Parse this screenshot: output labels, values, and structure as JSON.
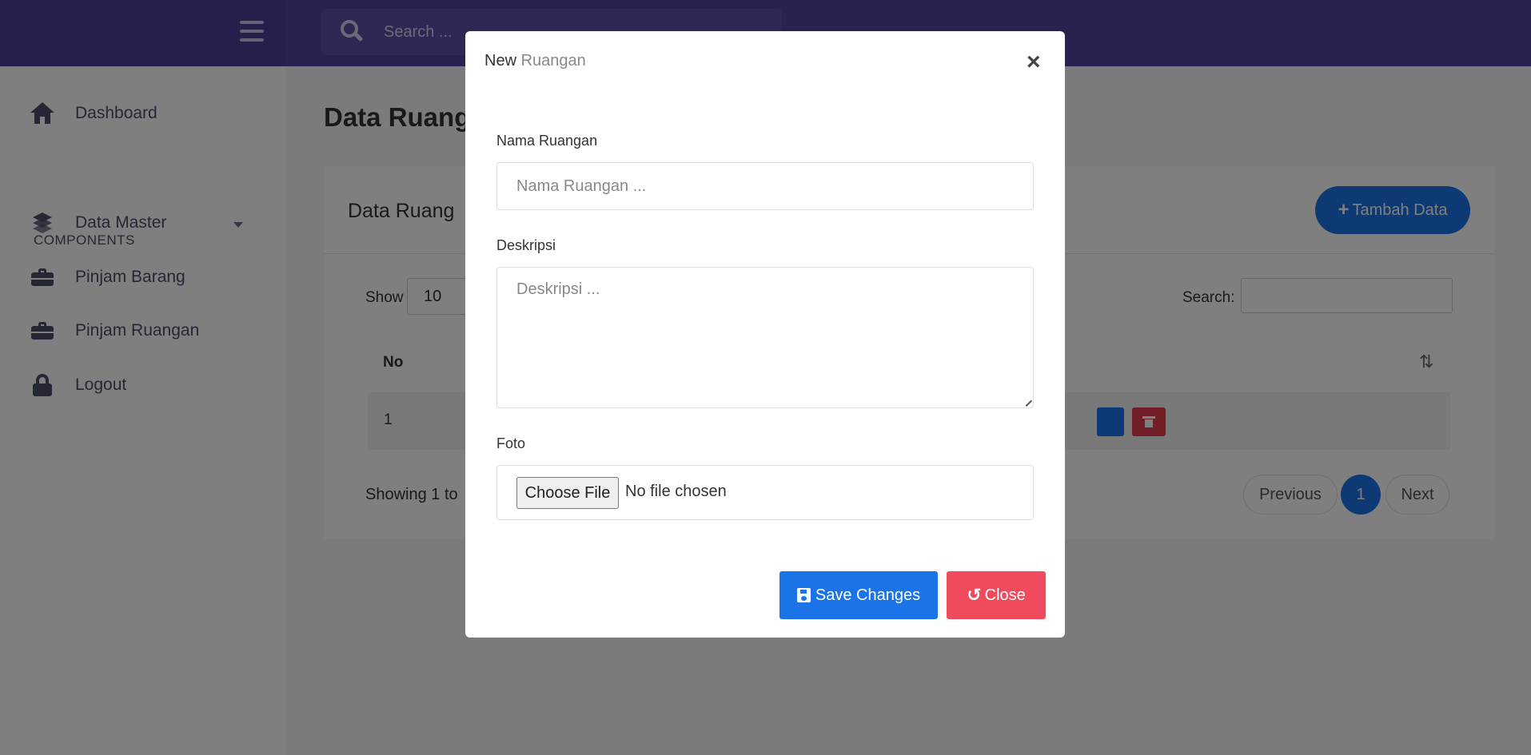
{
  "topbar": {
    "search_placeholder": "Search ..."
  },
  "sidebar": {
    "dashboard": "Dashboard",
    "section": "COMPONENTS",
    "data_master": "Data Master",
    "pinjam_barang": "Pinjam Barang",
    "pinjam_ruangan": "Pinjam Ruangan",
    "logout": "Logout"
  },
  "main": {
    "title": "Data Ruang",
    "card_title": "Data Ruang",
    "add_button": "Tambah Data",
    "show_label": "Show",
    "show_value": "10",
    "search_label": "Search:",
    "col_no": "No",
    "row_no": "1",
    "showing": "Showing 1 to",
    "prev": "Previous",
    "page": "1",
    "next": "Next"
  },
  "modal": {
    "title_new": "New",
    "title_entity": "Ruangan",
    "close_symbol": "×",
    "name_label": "Nama Ruangan",
    "name_placeholder": "Nama Ruangan ...",
    "desc_label": "Deskripsi",
    "desc_placeholder": "Deskripsi ...",
    "photo_label": "Foto",
    "file_button": "Choose File",
    "file_status": "No file chosen",
    "save_label": "Save Changes",
    "close_label": "Close"
  },
  "colors": {
    "topbar": "#4f44a0",
    "primary": "#1a74e8",
    "danger": "#f04b5c"
  }
}
